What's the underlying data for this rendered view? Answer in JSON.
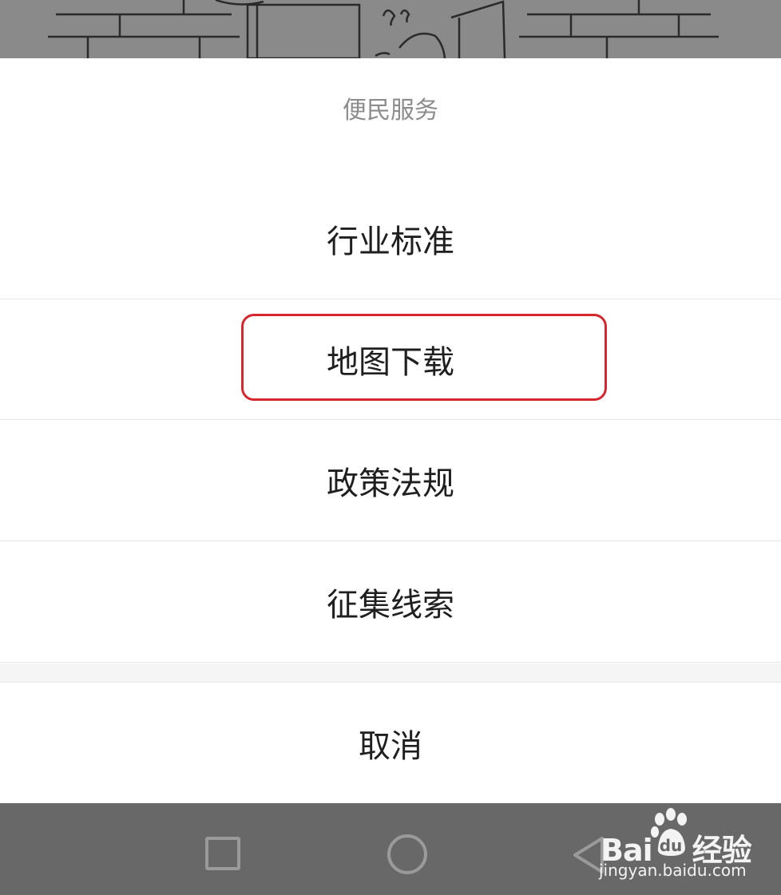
{
  "sheet": {
    "title": "便民服务",
    "options": [
      {
        "label": "行业标准"
      },
      {
        "label": "地图下载",
        "highlighted": true
      },
      {
        "label": "政策法规"
      },
      {
        "label": "征集线索"
      }
    ],
    "cancel_label": "取消"
  },
  "navbar": {
    "buttons": [
      "recent-apps-icon",
      "home-icon",
      "back-icon"
    ]
  },
  "watermark": {
    "brand": "Bai",
    "brand_tail": "经验",
    "url": "jingyan.baidu.com"
  },
  "colors": {
    "highlight_border": "#d6262e",
    "navbar_bg": "#686868",
    "overlay_bg": "#8a8a8a"
  }
}
